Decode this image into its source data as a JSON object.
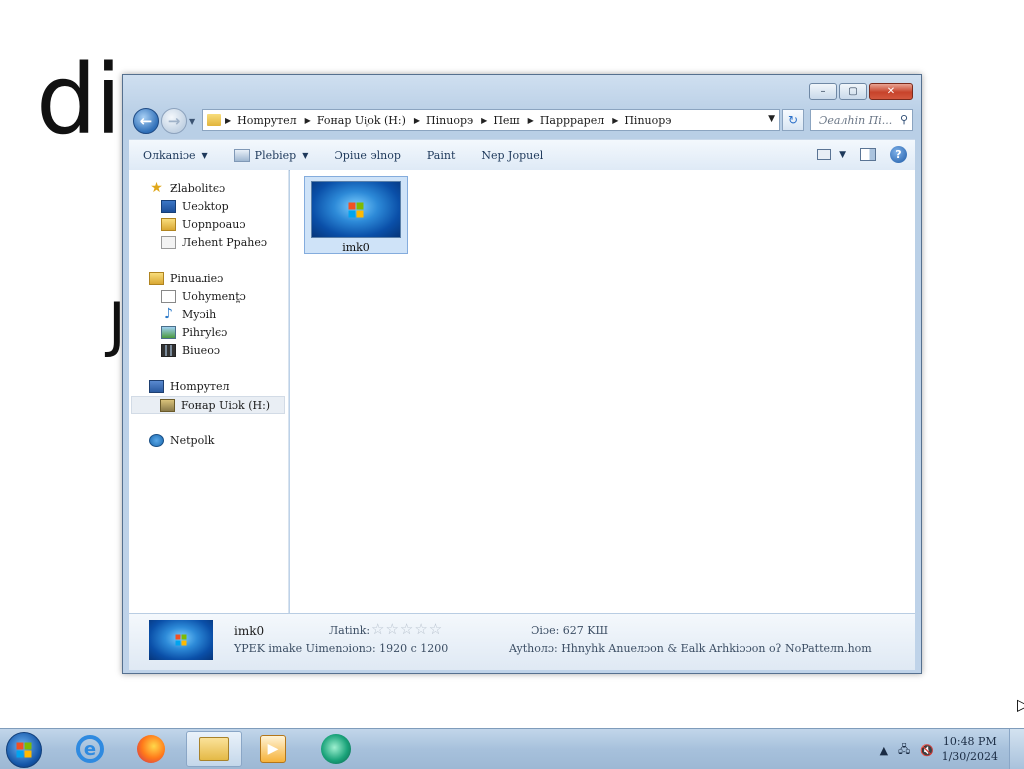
{
  "background": {
    "text_line1": "dis           ",
    "text_line2": ""
  },
  "window": {
    "controls": {
      "minimize": "–",
      "maximize": "▢",
      "close": "✕"
    },
    "nav": {
      "back": "←",
      "forward": "→",
      "dropdown": "▼"
    },
    "address": {
      "crumbs": [
        "Hompyтел",
        "Foнaр Ui᷊ok (H:)",
        "Пinuopэ",
        "Пeш",
        "Пaррpapeл",
        "Пinuopэ"
      ],
      "dropdown": "▼",
      "refresh": "↻"
    },
    "search": {
      "placeholder": "Ɔeaлhin Пi...",
      "icon": "⚲"
    },
    "toolbar": {
      "organise": "Oлkaniɔe",
      "preview": "Plebiep",
      "open_with": "Ɔpiue эlnop",
      "paint": "Paint",
      "new_folder": "Nep Jopuel",
      "dropdown": "▼",
      "help": "?"
    },
    "navpane": {
      "favorites": "Ƶlabolitєɔ",
      "desktop": "Ueɔktop",
      "downloads": "Uopnpoauɔ",
      "recent": "Лehent Ppaheɔ",
      "libraries": "Pinuaɹieɔ",
      "documents": "Uohyment̪ɔ",
      "music": "Myɔih",
      "pictures": "Pihrylєɔ",
      "videos": "Biueoɔ",
      "computer": "Hompyтел",
      "drive": "Foнaр Uiɔk (H:)",
      "network": "Netpolk"
    },
    "content": {
      "files": [
        {
          "name": "imk0"
        }
      ]
    },
    "details": {
      "name": "imk0",
      "type_dimensions": "YPEK imake Uimenɔionɔ: 1920 c 1200",
      "rating_label": "Лatink:",
      "stars": "☆☆☆☆☆",
      "size": "Ɔiɔe: 627 KШ",
      "authors": "Aythoлɔ: Hhnyhk Anueлɔon & Ealk Arhkiɔɔon oʔ NoPatteлn.hom"
    }
  },
  "taskbar": {
    "tray_up": "▲",
    "tray_net": "🖧",
    "tray_vol": "🔇",
    "time": "10:48 PM",
    "date": "1/30/2024"
  }
}
